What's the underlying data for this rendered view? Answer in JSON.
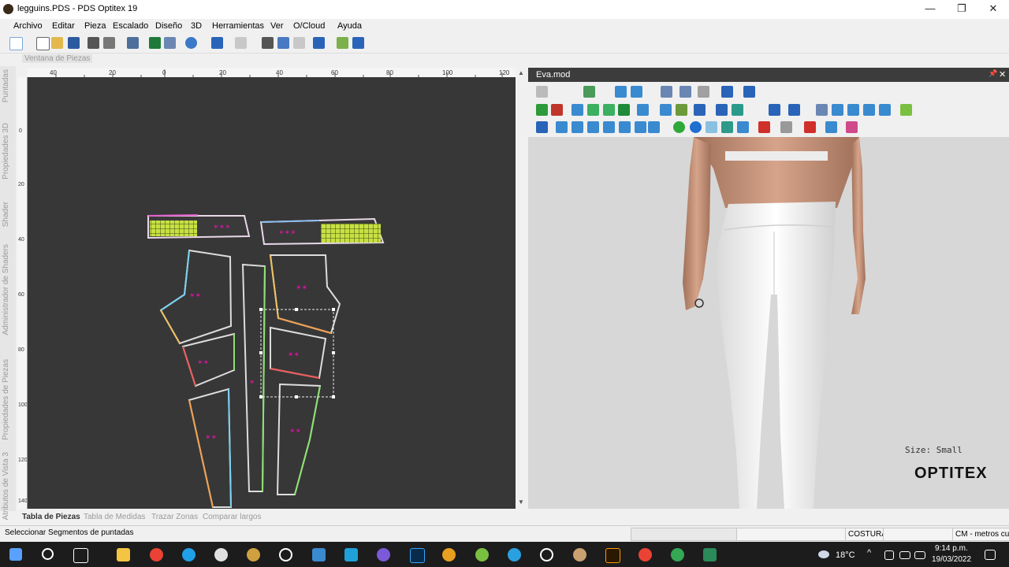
{
  "window": {
    "title": "legguins.PDS - PDS Optitex 19",
    "min_symbol": "—",
    "max_symbol": "❐",
    "close_symbol": "✕"
  },
  "menu": [
    "Archivo",
    "Editar",
    "Pieza",
    "Escalado",
    "Diseño",
    "3D",
    "Herramientas",
    "Ver",
    "O/Cloud",
    "Ayuda"
  ],
  "piece_window": {
    "title": "Ventana de Piezas",
    "ruler_h_labels": [
      "40",
      "20",
      "0",
      "20",
      "40",
      "60",
      "80",
      "100",
      "120"
    ],
    "ruler_v_labels": [
      "0",
      "20",
      "40",
      "60",
      "80",
      "100",
      "120",
      "140"
    ],
    "left_tabs": [
      "Puntadas",
      "Propiedades 3D",
      "Shader",
      "Administrador de Shaders",
      "Propiedades de Piezas",
      "Atributos de Vista 3"
    ],
    "bottom_tabs": [
      "Tabla de Piezas",
      "Tabla de Medidas",
      "Trazar Zonas",
      "Comparar largos"
    ]
  },
  "view3d": {
    "title": "Eva.mod",
    "pin_symbol": "📌",
    "close_symbol": "✕",
    "size_label": "Size: Small",
    "brand": "OPTITEX"
  },
  "status": {
    "message": "Seleccionar Segmentos de puntadas",
    "mode": "COSTURA",
    "units": "CM - metros cu"
  },
  "taskbar": {
    "temperature": "18°C",
    "time": "9:14 p.m.",
    "date": "19/03/2022"
  },
  "colors": {
    "canvas": "#373737",
    "piece_label": "#d4179c",
    "grid_fill": "#c8e043",
    "viewport_bg": "#d7d7d7"
  }
}
